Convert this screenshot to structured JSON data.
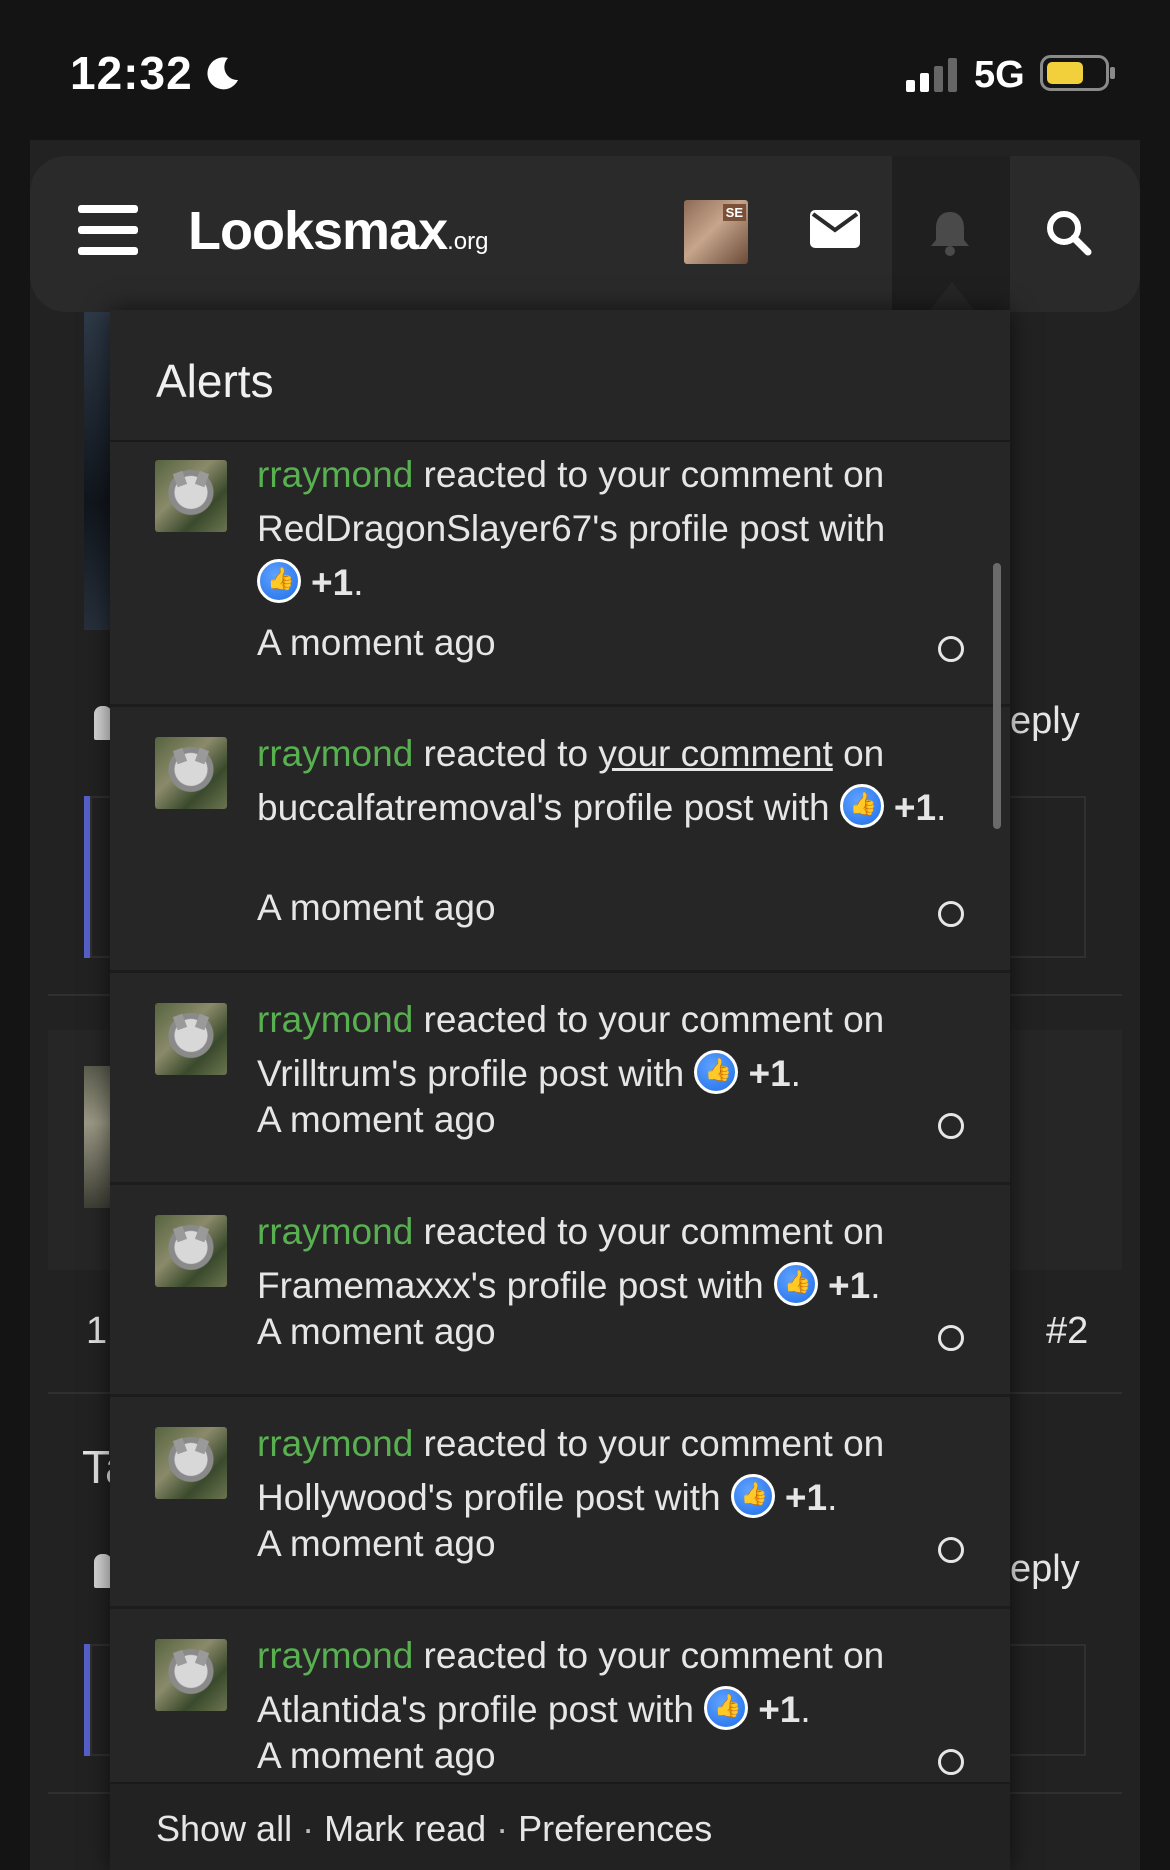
{
  "status_bar": {
    "time": "12:32",
    "network": "5G"
  },
  "header": {
    "logo_main": "Looksmax",
    "logo_suffix": ".org"
  },
  "nav_avatar_tag": "SE",
  "background": {
    "reply1": "eply",
    "post_num": "1",
    "post_ref": "#2",
    "ta": "Ta",
    "reply2": "eply"
  },
  "alerts_popup": {
    "title": "Alerts",
    "items": [
      {
        "user": "rraymond",
        "pre": " reacted to ",
        "link": "your comment",
        "post": " on RedDragonSlayer67's profile post with ",
        "reaction": "+1",
        "end": ".",
        "time": "A moment ago"
      },
      {
        "user": "rraymond",
        "pre": " reacted to ",
        "link": "your comment",
        "post": " on buccalfatremoval's profile post with ",
        "reaction": "+1",
        "end": ".",
        "time": "A moment ago"
      },
      {
        "user": "rraymond",
        "pre": " reacted to ",
        "link": "your comment",
        "post": " on Vrilltrum's profile post with ",
        "reaction": "+1",
        "end": ".",
        "time": "A moment ago"
      },
      {
        "user": "rraymond",
        "pre": " reacted to ",
        "link": "your comment",
        "post": " on Framemaxxx's profile post with ",
        "reaction": "+1",
        "end": ".",
        "time": "A moment ago"
      },
      {
        "user": "rraymond",
        "pre": " reacted to ",
        "link": "your comment",
        "post": " on Hollywood's profile post with ",
        "reaction": "+1",
        "end": ".",
        "time": "A moment ago"
      },
      {
        "user": "rraymond",
        "pre": " reacted to ",
        "link": "your comment",
        "post": " on Atlantida's profile post with ",
        "reaction": "+1",
        "end": ".",
        "time": "A moment ago"
      }
    ],
    "footer": {
      "show_all": "Show all",
      "mark_read": "Mark read",
      "preferences": "Preferences",
      "separator": "·"
    }
  },
  "colors": {
    "username": "#58b050",
    "quote_bar": "#5560c8",
    "react_blue": "#1f6fe8"
  }
}
